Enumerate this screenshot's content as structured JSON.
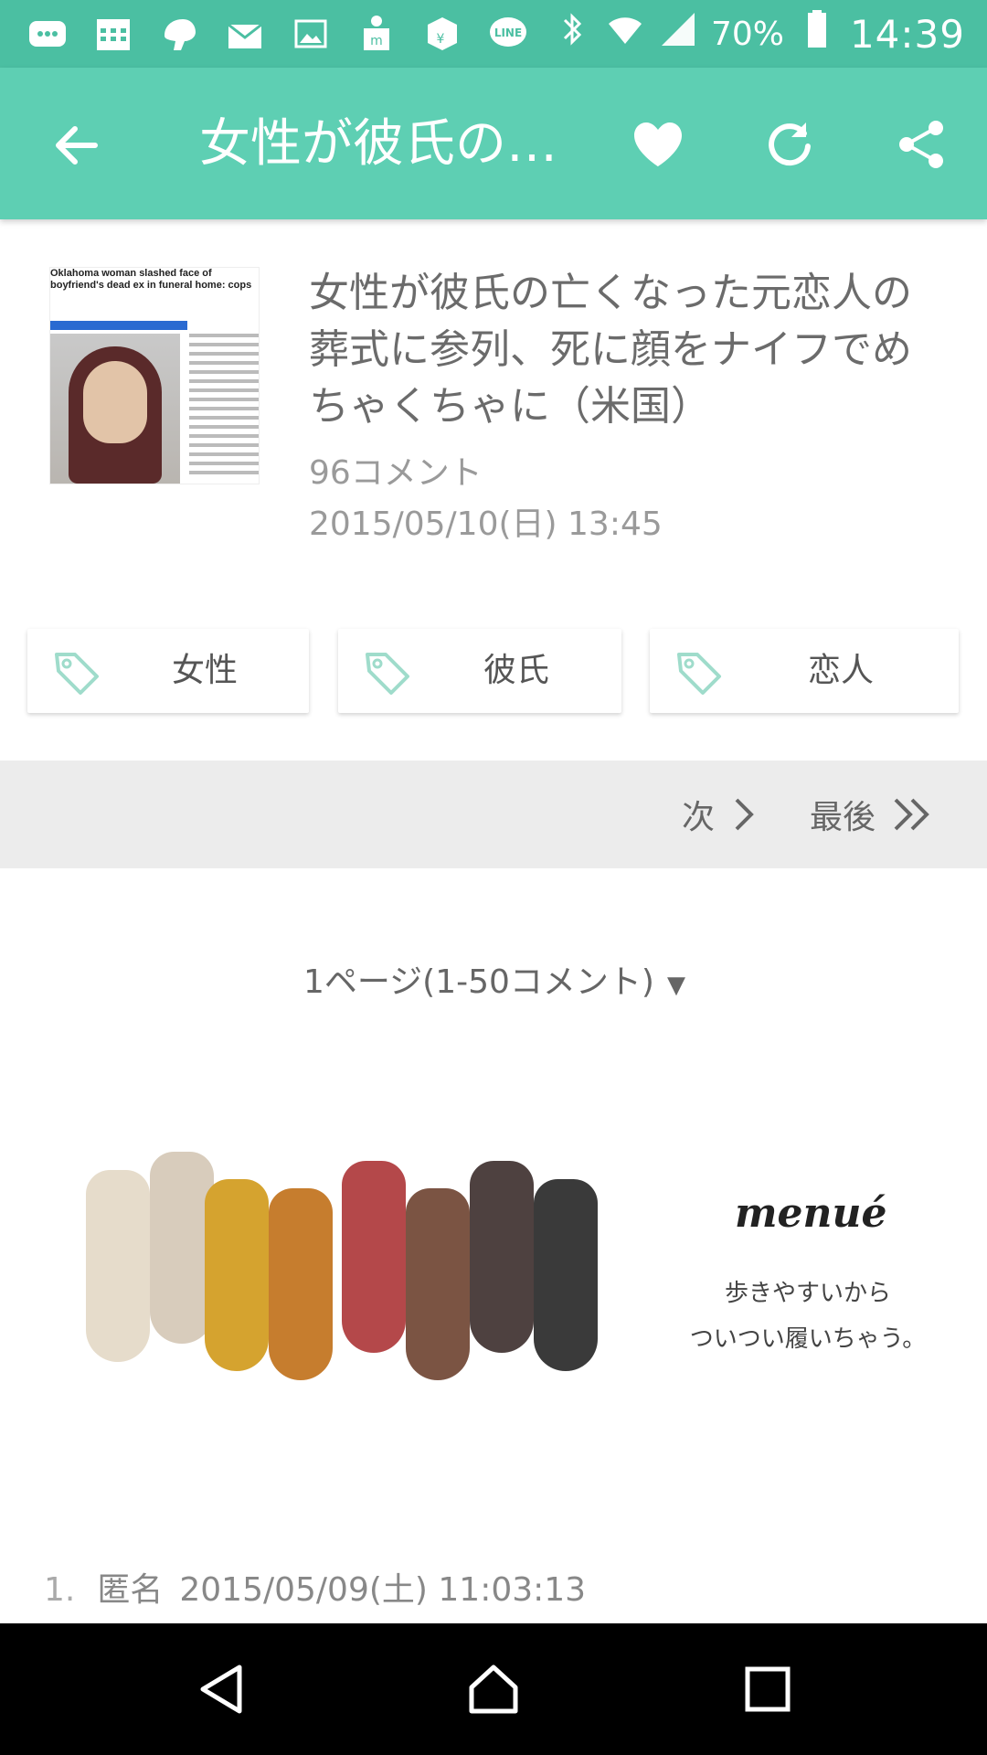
{
  "statusbar": {
    "battery": "70%",
    "time": "14:39",
    "line_label": "LINE",
    "icons": [
      "message-icon",
      "calendar-icon",
      "app-icon",
      "mail-icon",
      "image-icon",
      "package-icon",
      "dice-icon",
      "line-icon",
      "bluetooth-icon",
      "wifi-icon",
      "signal-icon",
      "battery-icon"
    ]
  },
  "appbar": {
    "title": "女性が彼氏の…",
    "actions": [
      "favorite-icon",
      "refresh-icon",
      "share-icon"
    ]
  },
  "article": {
    "thumb_headline": "Oklahoma woman slashed face of boyfriend's dead ex in funeral home: cops",
    "title": "女性が彼氏の亡くなった元恋人の葬式に参列、死に顔をナイフでめちゃくちゃに（米国）",
    "comments": "96コメント",
    "date": "2015/05/10(日) 13:45"
  },
  "tags": [
    "女性",
    "彼氏",
    "恋人"
  ],
  "pager": {
    "next": "次",
    "last": "最後"
  },
  "page_info": "1ページ(1-50コメント)",
  "ad": {
    "brand": "menué",
    "copy_line1": "歩きやすいから",
    "copy_line2": "ついつい履いちゃう。"
  },
  "first_comment": {
    "number": "1.",
    "name": "匿名",
    "datetime": "2015/05/09(土) 11:03:13"
  },
  "colors": {
    "accent": "#5ecfb3",
    "statusbar": "#4bbfa2",
    "tag_icon": "#9fdccb"
  }
}
